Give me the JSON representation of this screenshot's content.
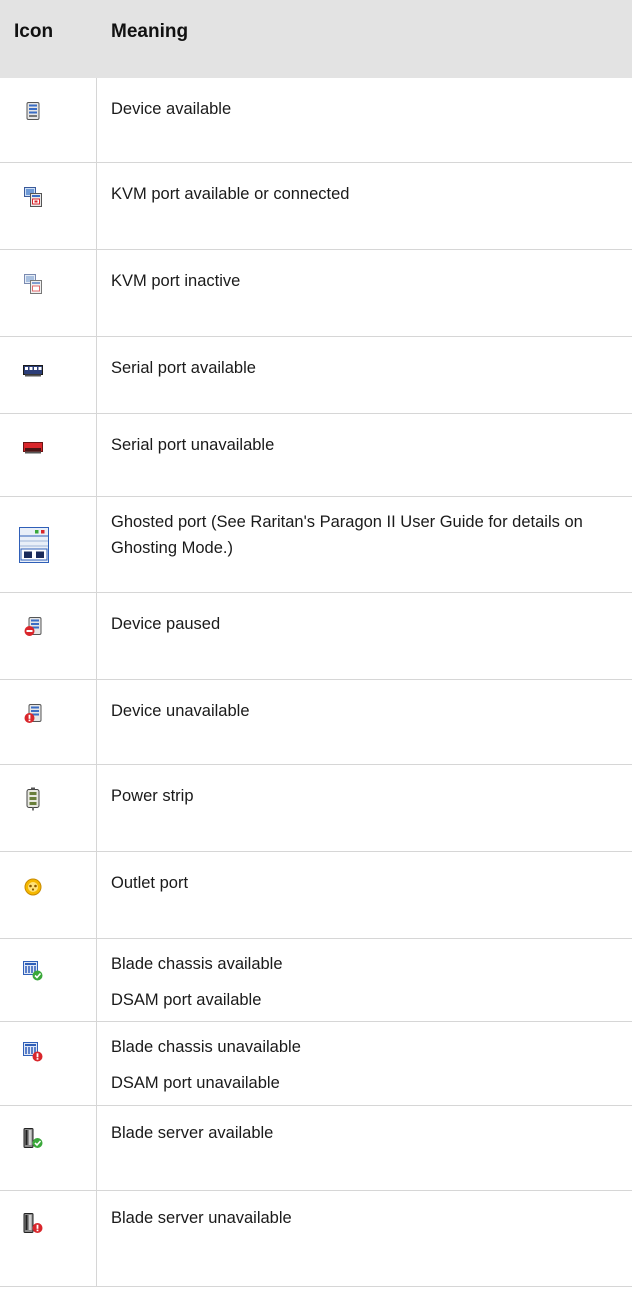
{
  "header": {
    "icon_label": "Icon",
    "meaning_label": "Meaning"
  },
  "rows": [
    {
      "icon": "device-available-icon",
      "text": "Device available"
    },
    {
      "icon": "kvm-port-available-icon",
      "text": "KVM port available or connected"
    },
    {
      "icon": "kvm-port-inactive-icon",
      "text": "KVM port inactive"
    },
    {
      "icon": "serial-port-available-icon",
      "text": "Serial port available"
    },
    {
      "icon": "serial-port-unavailable-icon",
      "text": "Serial port unavailable"
    },
    {
      "icon": "ghosted-port-icon",
      "text": "Ghosted port (See Raritan's Paragon II User Guide for details on Ghosting Mode.)"
    },
    {
      "icon": "device-paused-icon",
      "text": "Device paused"
    },
    {
      "icon": "device-unavailable-icon",
      "text": "Device unavailable"
    },
    {
      "icon": "power-strip-icon",
      "text": "Power strip"
    },
    {
      "icon": "outlet-port-icon",
      "text": "Outlet port"
    },
    {
      "icon": "blade-chassis-available-icon",
      "text": "Blade chassis available",
      "text2": "DSAM port available"
    },
    {
      "icon": "blade-chassis-unavailable-icon",
      "text": "Blade chassis unavailable",
      "text2": "DSAM port unavailable"
    },
    {
      "icon": "blade-server-available-icon",
      "text": "Blade server available"
    },
    {
      "icon": "blade-server-unavailable-icon",
      "text": "Blade server unavailable"
    }
  ],
  "colors": {
    "header_bg": "#e3e3e3",
    "grid": "#d6d6d6",
    "red": "#d9262b",
    "green": "#3aa83a",
    "blue": "#2f5fb8"
  }
}
